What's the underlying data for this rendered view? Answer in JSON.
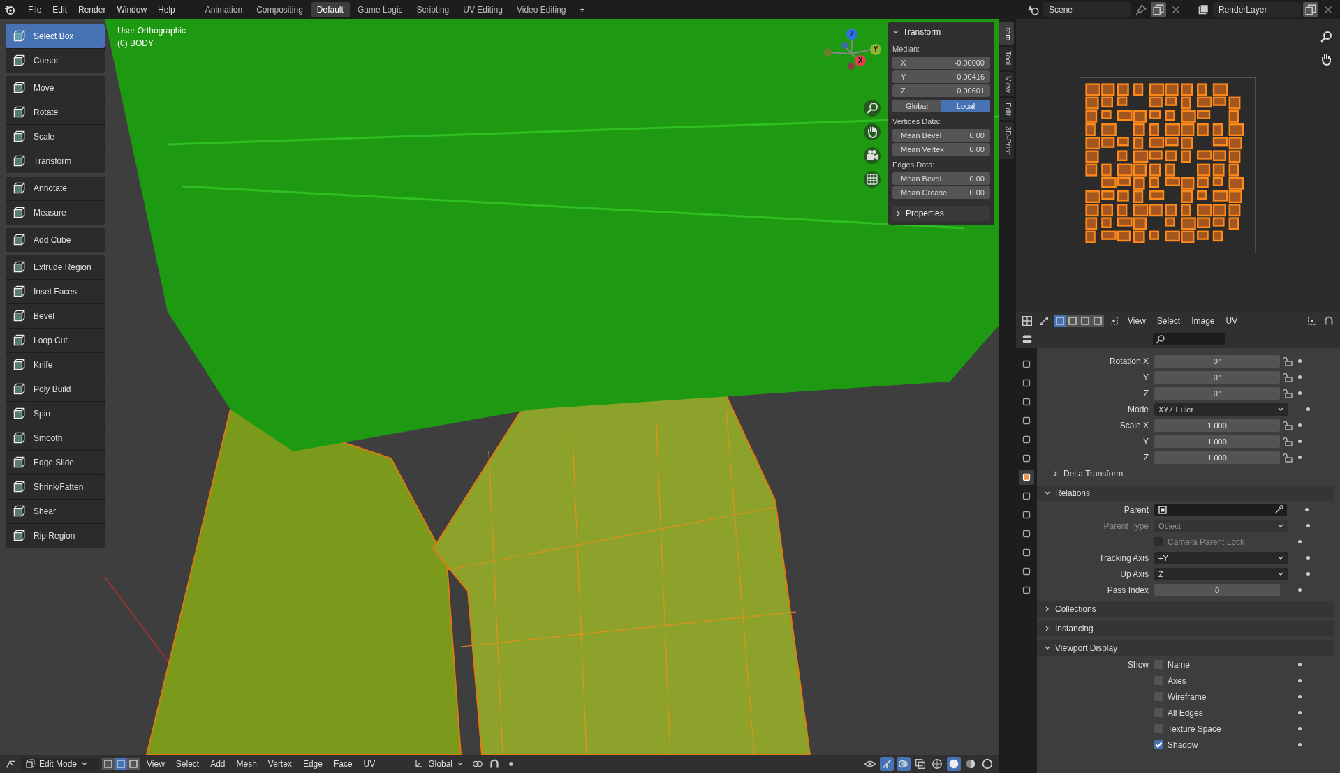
{
  "top_bar": {
    "menus": [
      "File",
      "Edit",
      "Render",
      "Window",
      "Help"
    ],
    "workspaces": [
      {
        "label": "Animation",
        "selected": false
      },
      {
        "label": "Compositing",
        "selected": false
      },
      {
        "label": "Default",
        "selected": true
      },
      {
        "label": "Game Logic",
        "selected": false
      },
      {
        "label": "Scripting",
        "selected": false
      },
      {
        "label": "UV Editing",
        "selected": false
      },
      {
        "label": "Video Editing",
        "selected": false
      }
    ],
    "add_workspace": "+",
    "scene": "Scene",
    "view_layer": "RenderLayer"
  },
  "toolbar": {
    "groups": [
      {
        "tools": [
          {
            "label": "Select Box",
            "selected": true
          },
          {
            "label": "Cursor",
            "selected": false
          }
        ]
      },
      {
        "tools": [
          {
            "label": "Move",
            "selected": false
          },
          {
            "label": "Rotate",
            "selected": false
          },
          {
            "label": "Scale",
            "selected": false
          },
          {
            "label": "Transform",
            "selected": false
          }
        ]
      },
      {
        "tools": [
          {
            "label": "Annotate",
            "selected": false
          },
          {
            "label": "Measure",
            "selected": false
          }
        ]
      },
      {
        "tools": [
          {
            "label": "Add Cube",
            "selected": false
          }
        ]
      },
      {
        "tools": [
          {
            "label": "Extrude Region",
            "selected": false
          },
          {
            "label": "Inset Faces",
            "selected": false
          },
          {
            "label": "Bevel",
            "selected": false
          },
          {
            "label": "Loop Cut",
            "selected": false
          },
          {
            "label": "Knife",
            "selected": false
          },
          {
            "label": "Poly Build",
            "selected": false
          },
          {
            "label": "Spin",
            "selected": false
          },
          {
            "label": "Smooth",
            "selected": false
          },
          {
            "label": "Edge Slide",
            "selected": false
          },
          {
            "label": "Shrink/Fatten",
            "selected": false
          },
          {
            "label": "Shear",
            "selected": false
          },
          {
            "label": "Rip Region",
            "selected": false
          }
        ]
      }
    ]
  },
  "viewport": {
    "view_name": "User Orthographic",
    "object_name": "(0) BODY",
    "gizmo_axes": [
      {
        "label": "Z",
        "color": "#2f73e0"
      },
      {
        "label": "Y",
        "color": "#8bb534"
      },
      {
        "label": "X",
        "color": "#e6404f"
      }
    ]
  },
  "n_panel": {
    "rows": [
      {
        "kind": "header",
        "label": "Transform",
        "expanded": true
      },
      {
        "kind": "caption",
        "label": "Median:"
      },
      {
        "kind": "number",
        "label": "X",
        "value": "-0.00000"
      },
      {
        "kind": "number",
        "label": "Y",
        "value": "0.00416"
      },
      {
        "kind": "number",
        "label": "Z",
        "value": "0.00601"
      },
      {
        "kind": "toggle",
        "options": [
          {
            "label": "Global",
            "selected": false
          },
          {
            "label": "Local",
            "selected": true
          }
        ]
      },
      {
        "kind": "caption",
        "label": "Vertices Data:"
      },
      {
        "kind": "field",
        "label": "Mean Bevel",
        "value": "0.00"
      },
      {
        "kind": "field",
        "label": "Mean Vertex",
        "value": "0.00"
      },
      {
        "kind": "caption",
        "label": "Edges Data:"
      },
      {
        "kind": "field",
        "label": "Mean Bevel",
        "value": "0.00"
      },
      {
        "kind": "field",
        "label": "Mean Crease",
        "value": "0.00"
      },
      {
        "kind": "header",
        "label": "Properties",
        "expanded": false
      }
    ]
  },
  "sidebar_tabs": [
    {
      "label": "Item",
      "selected": true
    },
    {
      "label": "Tool",
      "selected": false
    },
    {
      "label": "View",
      "selected": false
    },
    {
      "label": "Edit",
      "selected": false
    },
    {
      "label": "3D-Print",
      "selected": false
    }
  ],
  "uv_editor": {
    "select_modes": [
      {
        "selected": true
      },
      {
        "selected": false
      },
      {
        "selected": false
      },
      {
        "selected": false
      }
    ],
    "menus": [
      "View",
      "Select",
      "Image",
      "UV"
    ]
  },
  "properties": {
    "tabs": [
      {
        "selected": false
      },
      {
        "selected": false
      },
      {
        "selected": false
      },
      {
        "selected": false
      },
      {
        "selected": false
      },
      {
        "selected": false
      },
      {
        "selected": true
      },
      {
        "selected": false
      },
      {
        "selected": false
      },
      {
        "selected": false
      },
      {
        "selected": false
      },
      {
        "selected": false
      },
      {
        "selected": false
      }
    ],
    "rows": [
      {
        "kind": "number",
        "label": "Rotation X",
        "value": "0°",
        "locked": false,
        "disabled": false
      },
      {
        "kind": "number",
        "label": "Y",
        "value": "0°",
        "locked": false,
        "disabled": false
      },
      {
        "kind": "number",
        "label": "Z",
        "value": "0°",
        "locked": false,
        "disabled": false
      },
      {
        "kind": "select",
        "label": "Mode",
        "value": "XYZ Euler",
        "disabled": false
      },
      {
        "kind": "number",
        "label": "Scale X",
        "value": "1.000",
        "locked": false,
        "disabled": false
      },
      {
        "kind": "number",
        "label": "Y",
        "value": "1.000",
        "locked": false,
        "disabled": false
      },
      {
        "kind": "number",
        "label": "Z",
        "value": "1.000",
        "locked": false,
        "disabled": false
      },
      {
        "kind": "subsection",
        "label": "Delta Transform",
        "expanded": false
      },
      {
        "kind": "section",
        "label": "Relations",
        "expanded": true
      },
      {
        "kind": "object",
        "label": "Parent",
        "disabled": false
      },
      {
        "kind": "select",
        "label": "Parent Type",
        "value": "Object",
        "disabled": true
      },
      {
        "kind": "check",
        "text": "Camera Parent Lock",
        "checked": false,
        "disabled": true
      },
      {
        "kind": "select",
        "label": "Tracking Axis",
        "value": "+Y",
        "disabled": false
      },
      {
        "kind": "select",
        "label": "Up Axis",
        "value": "Z",
        "disabled": false
      },
      {
        "kind": "number",
        "label": "Pass Index",
        "value": "0",
        "disabled": false
      },
      {
        "kind": "section",
        "label": "Collections",
        "expanded": false
      },
      {
        "kind": "section",
        "label": "Instancing",
        "expanded": false
      },
      {
        "kind": "section",
        "label": "Viewport Display",
        "expanded": true
      },
      {
        "kind": "check",
        "label": "Show",
        "text": "Name",
        "checked": false,
        "disabled": false
      },
      {
        "kind": "check",
        "text": "Axes",
        "checked": false,
        "disabled": false
      },
      {
        "kind": "check",
        "text": "Wireframe",
        "checked": false,
        "disabled": false
      },
      {
        "kind": "check",
        "text": "All Edges",
        "checked": false,
        "disabled": false
      },
      {
        "kind": "check",
        "text": "Texture Space",
        "checked": false,
        "disabled": false
      },
      {
        "kind": "check",
        "text": "Shadow",
        "checked": true,
        "disabled": false
      }
    ]
  },
  "viewport_header": {
    "mode": "Edit Mode",
    "select_modes": [
      {
        "selected": false
      },
      {
        "selected": true
      },
      {
        "selected": false
      }
    ],
    "menus": [
      "View",
      "Select",
      "Add",
      "Mesh",
      "Vertex",
      "Edge",
      "Face",
      "UV"
    ],
    "orientation": "Global"
  }
}
